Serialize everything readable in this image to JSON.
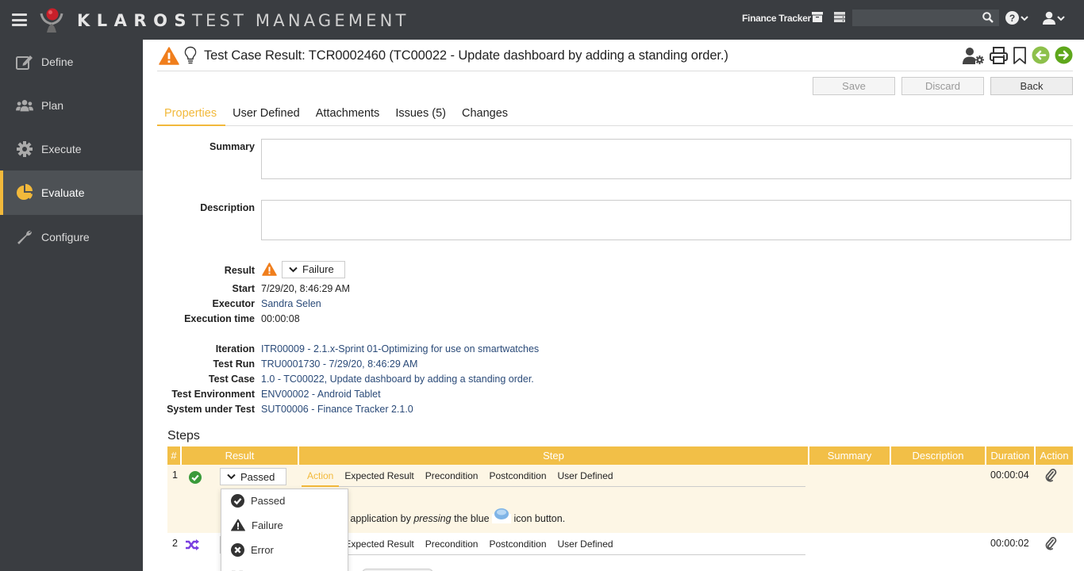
{
  "header": {
    "brand": "KLAROS",
    "brand_sub": "TEST MANAGEMENT",
    "project_name": "Finance Tracker",
    "search_placeholder": "",
    "icons": [
      "archive-icon",
      "server-icon",
      "search-icon",
      "help-icon",
      "user-icon"
    ]
  },
  "sidebar": {
    "items": [
      {
        "label": "Define",
        "icon": "edit-icon",
        "active": false
      },
      {
        "label": "Plan",
        "icon": "users-icon",
        "active": false
      },
      {
        "label": "Execute",
        "icon": "gear-icon",
        "active": false
      },
      {
        "label": "Evaluate",
        "icon": "pie-chart-icon",
        "active": true
      },
      {
        "label": "Configure",
        "icon": "wrench-icon",
        "active": false
      }
    ]
  },
  "page": {
    "title": "Test Case Result: TCR0002460 (TC00022 - Update dashboard by adding a standing order.)",
    "buttons": {
      "save": "Save",
      "discard": "Discard",
      "back": "Back"
    },
    "tabs": [
      {
        "label": "Properties",
        "active": true
      },
      {
        "label": "User Defined",
        "active": false
      },
      {
        "label": "Attachments",
        "active": false
      },
      {
        "label": "Issues (5)",
        "active": false
      },
      {
        "label": "Changes",
        "active": false
      }
    ]
  },
  "form": {
    "summary_label": "Summary",
    "summary_value": "",
    "description_label": "Description",
    "description_value": "",
    "result_label": "Result",
    "result_value": "Failure",
    "start_label": "Start",
    "start_value": "7/29/20, 8:46:29 AM",
    "executor_label": "Executor",
    "executor_value": "Sandra Selen",
    "exec_time_label": "Execution time",
    "exec_time_value": "00:00:08",
    "iteration_label": "Iteration",
    "iteration_value": "ITR00009 - 2.1.x-Sprint 01-Optimizing for use on smartwatches",
    "test_run_label": "Test Run",
    "test_run_value": "TRU0001730 - 7/29/20, 8:46:29 AM",
    "test_case_label": "Test Case",
    "test_case_value": "1.0 - TC00022, Update dashboard by adding a standing order.",
    "test_env_label": "Test Environment",
    "test_env_value": "ENV00002 - Android Tablet",
    "sut_label": "System under Test",
    "sut_value": "SUT00006 - Finance Tracker 2.1.0"
  },
  "steps": {
    "title": "Steps",
    "columns": [
      "#",
      "Result",
      "Step",
      "Summary",
      "Description",
      "Duration",
      "Action"
    ],
    "step_tabs": [
      "Action",
      "Expected Result",
      "Precondition",
      "Postcondition",
      "User Defined"
    ],
    "rows": [
      {
        "num": "1",
        "status": "passed",
        "result": "Passed",
        "duration": "00:00:04",
        "text_pre": "e application by ",
        "text_em": "pressing",
        "text_post": " the blue",
        "text_end": "icon button."
      },
      {
        "num": "2",
        "status": "skipped",
        "result": "",
        "duration": "00:00:02"
      }
    ],
    "dropdown_options": [
      "Passed",
      "Failure",
      "Error"
    ]
  }
}
